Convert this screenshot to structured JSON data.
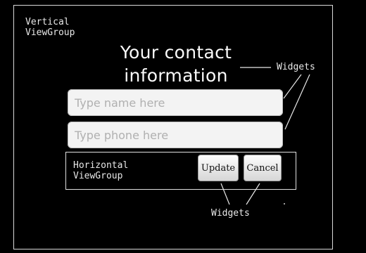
{
  "vertical_label": "Vertical\nViewGroup",
  "title_line1": "Your contact",
  "title_line2": "information",
  "name_field": {
    "placeholder": "Type name here"
  },
  "phone_field": {
    "placeholder": "Type phone here"
  },
  "horizontal_label": "Horizontal\nViewGroup",
  "update_button": "Update",
  "cancel_button": "Cancel",
  "widgets_label_top": "Widgets",
  "widgets_label_bottom": "Widgets"
}
